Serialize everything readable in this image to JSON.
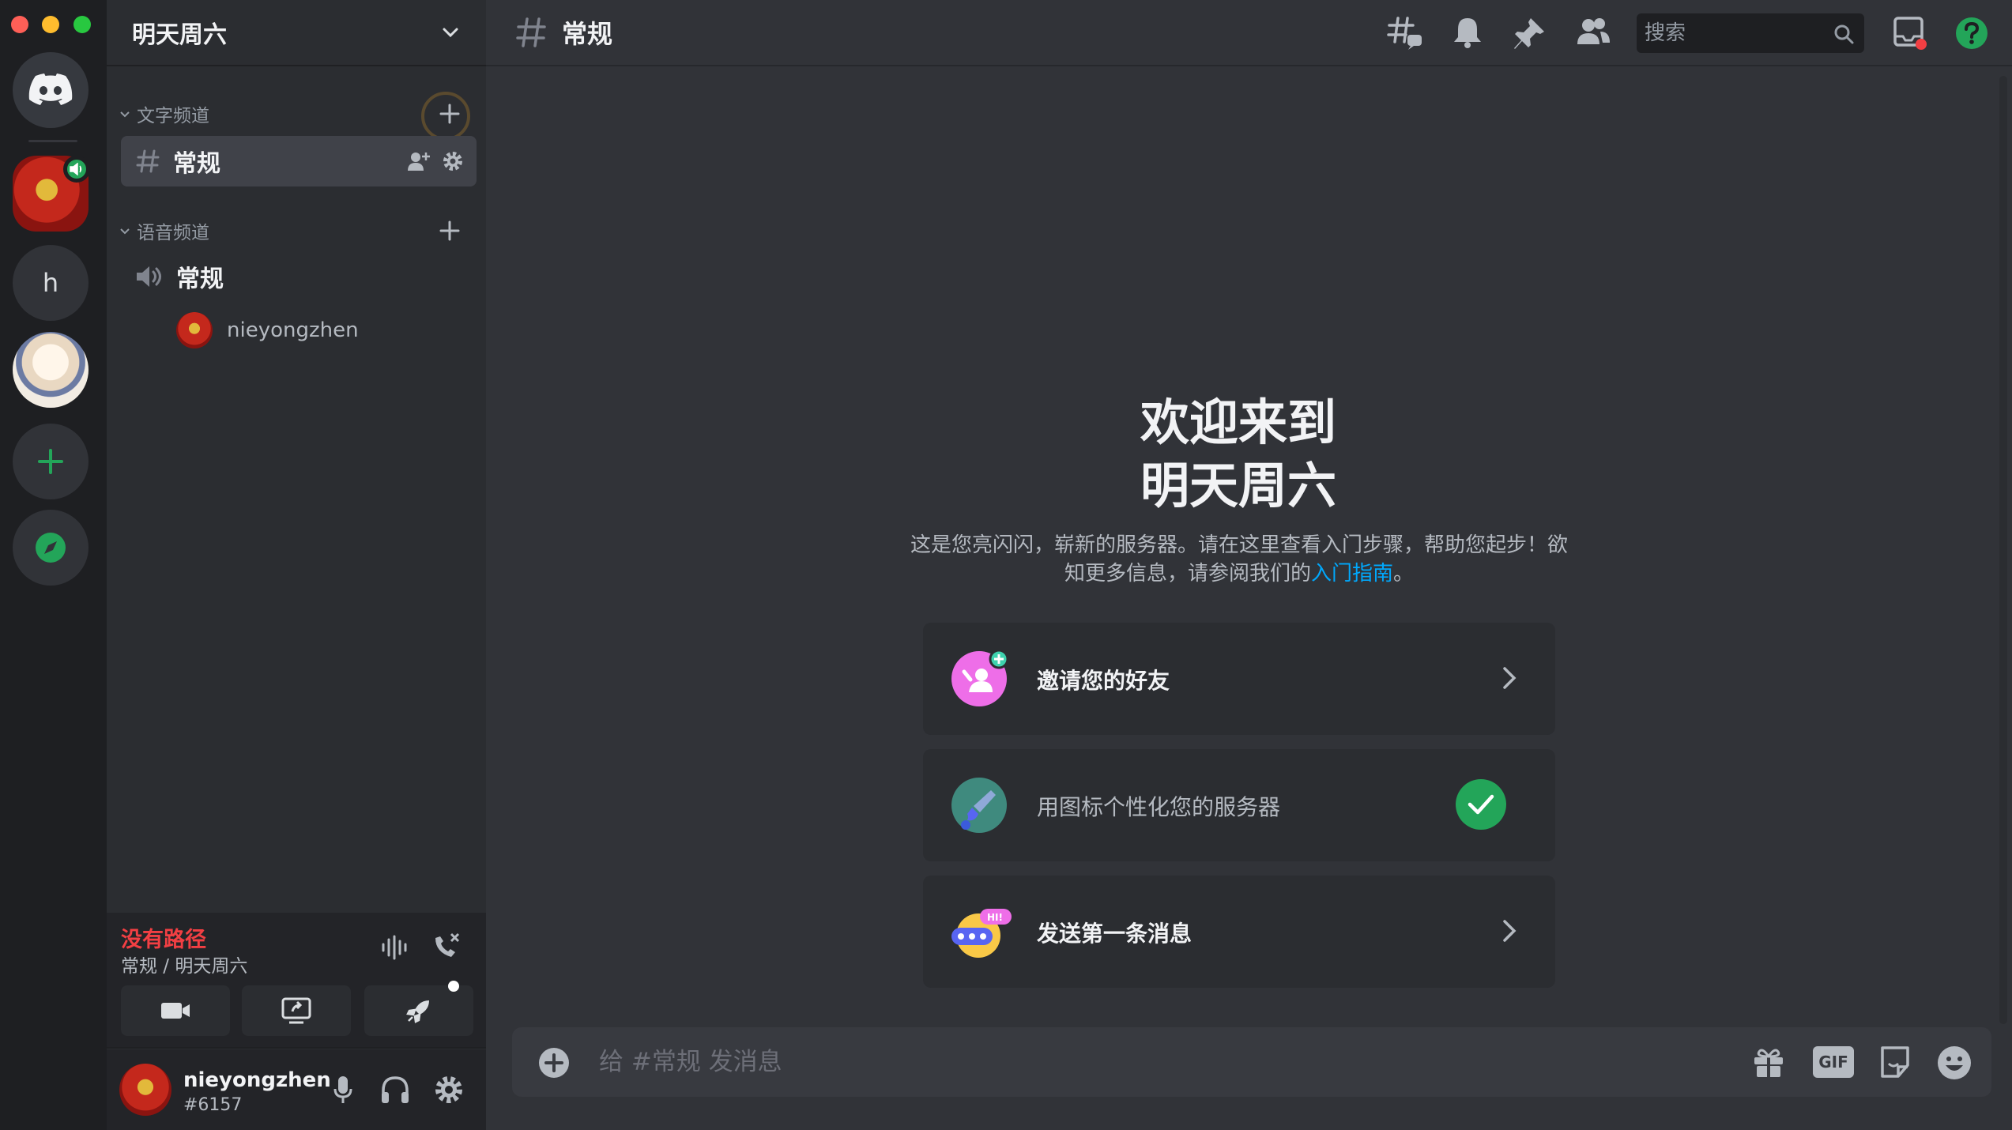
{
  "server": {
    "name": "明天周六"
  },
  "rail": {
    "server_h_letter": "h"
  },
  "categories": {
    "text": "文字频道",
    "voice": "语音频道"
  },
  "channels": {
    "text_channel": "常规",
    "voice_channel": "常规"
  },
  "voice_members": [
    {
      "name": "nieyongzhen"
    }
  ],
  "voice_panel": {
    "status": "没有路径",
    "location": "常规 / 明天周六"
  },
  "user": {
    "name": "nieyongzhen",
    "tag": "#6157"
  },
  "topbar": {
    "channel": "常规",
    "search_placeholder": "搜索"
  },
  "welcome": {
    "title_line1": "欢迎来到",
    "title_line2": "明天周六",
    "description": "这是您亮闪闪，崭新的服务器。请在这里查看入门步骤，帮助您起步！欲知更多信息，请参阅我们的",
    "link_text": "入门指南",
    "end_punct": "。"
  },
  "cards": [
    {
      "label": "邀请您的好友",
      "done": false
    },
    {
      "label": "用图标个性化您的服务器",
      "done": true
    },
    {
      "label": "发送第一条消息",
      "done": false
    }
  ],
  "send_card_bubble": "HI!",
  "composer": {
    "placeholder": "给 #常规 发消息",
    "gif_label": "GIF"
  },
  "colors": {
    "accent_green": "#23a559",
    "danger_red": "#f23f43",
    "link_blue": "#00a8fc",
    "blurple": "#5865f2"
  }
}
